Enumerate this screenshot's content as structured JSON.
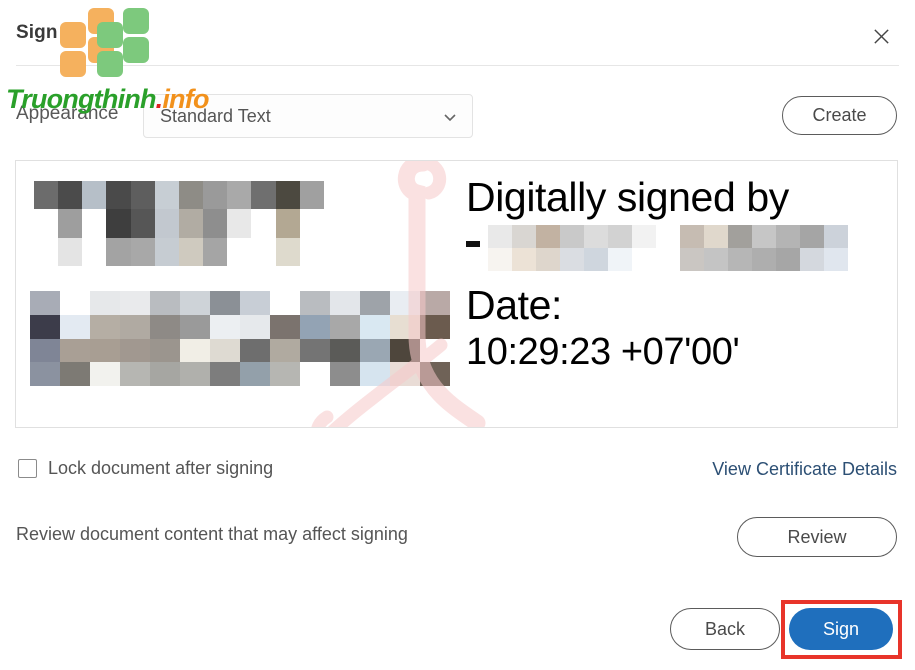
{
  "dialog": {
    "title": "Sign as",
    "sign_as_value": "",
    "close_icon": "close-icon"
  },
  "appearance": {
    "label": "Appearance",
    "selected": "Standard Text",
    "chevron_icon": "chevron-down-icon",
    "create_label": "Create"
  },
  "preview": {
    "line1": "Digitally signed by",
    "redacted_name": "",
    "line2": "Date:",
    "line3": "10:29:23 +07'00'",
    "left_redacted": "",
    "watermark_ribbon": "ribbon-watermark"
  },
  "options": {
    "lock_label": "Lock document after signing",
    "lock_checked": false,
    "cert_link": "View Certificate Details",
    "review_text": "Review document content that may affect signing",
    "review_button": "Review"
  },
  "footer": {
    "back_label": "Back",
    "sign_label": "Sign"
  },
  "watermark": {
    "brand_part1": "Truongthinh",
    "brand_dot": ".",
    "brand_part2": "info"
  },
  "colors": {
    "primary_blue": "#1f6fbd",
    "link_blue": "#2c4f74",
    "highlight_red": "#e8342a",
    "logo_orange": "#f5b15e",
    "logo_green": "#7dc97d",
    "brand_green": "#2aa02a",
    "brand_orange": "#f2911b",
    "brand_red": "#e02020"
  }
}
